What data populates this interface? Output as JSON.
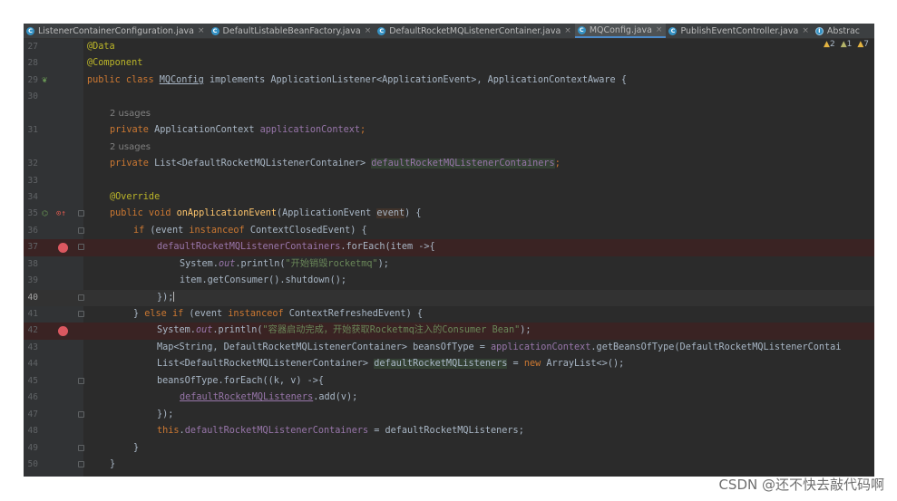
{
  "tabs": [
    {
      "label": "ListenerContainerConfiguration.java",
      "active": false
    },
    {
      "label": "DefaultListableBeanFactory.java",
      "active": false
    },
    {
      "label": "DefaultRocketMQListenerContainer.java",
      "active": false
    },
    {
      "label": "MQConfig.java",
      "active": true
    },
    {
      "label": "PublishEventController.java",
      "active": false
    },
    {
      "label": "Abstrac",
      "active": false
    }
  ],
  "inspections": {
    "warnings": "2",
    "weak_warnings": "1",
    "typos": "7"
  },
  "line_numbers": [
    "27",
    "28",
    "29",
    "30",
    "",
    "31",
    "",
    "32",
    "33",
    "34",
    "35",
    "36",
    "37",
    "38",
    "39",
    "40",
    "41",
    "42",
    "43",
    "44",
    "45",
    "46",
    "47",
    "48",
    "49",
    "50"
  ],
  "code": {
    "l27": "@Data",
    "l28": "@Component",
    "l29a": "public class ",
    "l29b": "MQConfig",
    "l29c": " implements ApplicationListener<ApplicationEvent>, ApplicationContextAware {",
    "hint1": "2 usages",
    "l31a": "private ",
    "l31b": "ApplicationContext ",
    "l31c": "applicationContext",
    "hint2": "2 usages",
    "l32a": "private ",
    "l32b": "List<DefaultRocketMQListenerContainer> ",
    "l32c": "defaultRocketMQListenerContainers",
    "l34": "@Override",
    "l35a": "public void ",
    "l35b": "onApplicationEvent",
    "l35c": "(ApplicationEvent ",
    "l35d": "event",
    "l35e": ") {",
    "l36a": "if ",
    "l36b": "(event ",
    "l36c": "instanceof ",
    "l36d": "ContextClosedEvent) {",
    "l37a": "defaultRocketMQListenerContainers",
    "l37b": ".forEach(item ->{",
    "l38a": "System.",
    "l38b": "out",
    "l38c": ".println(",
    "l38d": "\"开始销毁rocketmq\"",
    "l38e": ");",
    "l39": "item.getConsumer().shutdown();",
    "l40": "});",
    "l41a": "} ",
    "l41b": "else if ",
    "l41c": "(event ",
    "l41d": "instanceof ",
    "l41e": "ContextRefreshedEvent) {",
    "l42a": "System.",
    "l42b": "out",
    "l42c": ".println(",
    "l42d": "\"容器启动完成，开始获取Rocketmq注入的Consumer Bean\"",
    "l42e": ");",
    "l43a": "Map<String, DefaultRocketMQListenerContainer> beansOfType = ",
    "l43b": "applicationContext",
    "l43c": ".getBeansOfType(DefaultRocketMQListenerContai",
    "l44a": "List<DefaultRocketMQListenerContainer> ",
    "l44b": "defaultRocketMQListeners",
    "l44c": " = ",
    "l44d": "new ",
    "l44e": "ArrayList<>();",
    "l45": "beansOfType.forEach((k, v) ->{",
    "l46a": "defaultRocketMQListeners",
    "l46b": ".add(v);",
    "l47": "});",
    "l48a": "this",
    "l48b": ".",
    "l48c": "defaultRocketMQListenerContainers",
    "l48d": " = defaultRocketMQListeners;",
    "l49": "}",
    "l50": "}"
  },
  "watermark": "CSDN @还不快去敲代码啊",
  "colors": {
    "editor_bg": "#2b2b2b",
    "keyword": "#cc7832",
    "annotation": "#bbb529",
    "field": "#9876aa",
    "string": "#6a8759",
    "breakpoint": "#db5860"
  }
}
